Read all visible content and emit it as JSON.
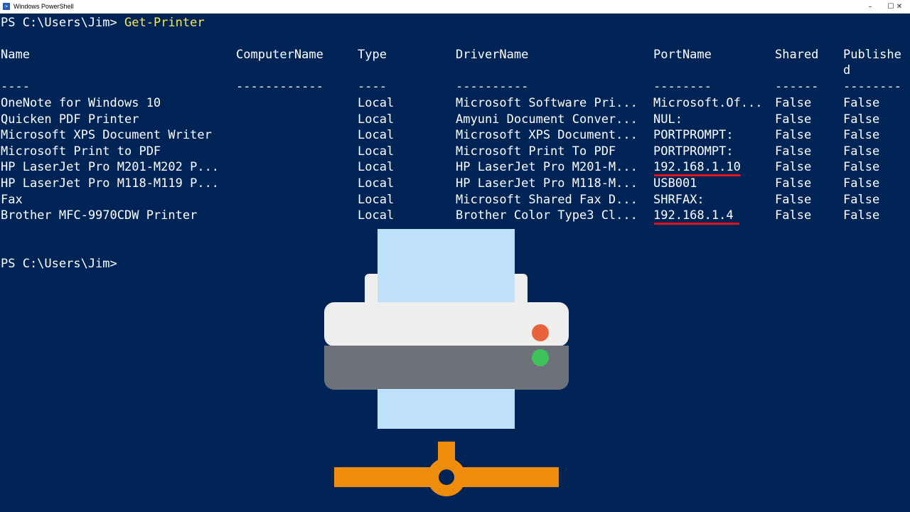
{
  "window": {
    "title": "Windows PowerShell",
    "controls": {
      "minimize": "–",
      "maximize": "☐",
      "close": "✕"
    }
  },
  "console": {
    "prompt1": "PS C:\\Users\\Jim>",
    "command": "Get-Printer",
    "headers": [
      "Name",
      "ComputerName",
      "Type",
      "DriverName",
      "PortName",
      "Shared",
      "Publishe"
    ],
    "header_wrap": "d",
    "separators": [
      "----",
      "------------",
      "----",
      "----------",
      "--------",
      "------",
      "--------"
    ],
    "rows": [
      [
        "OneNote for Windows 10",
        "",
        "Local",
        "Microsoft Software Pri...",
        "Microsoft.Of...",
        "False",
        "False"
      ],
      [
        "Quicken PDF Printer",
        "",
        "Local",
        "Amyuni Document Conver...",
        "NUL:",
        "False",
        "False"
      ],
      [
        "Microsoft XPS Document Writer",
        "",
        "Local",
        "Microsoft XPS Document...",
        "PORTPROMPT:",
        "False",
        "False"
      ],
      [
        "Microsoft Print to PDF",
        "",
        "Local",
        "Microsoft Print To PDF",
        "PORTPROMPT:",
        "False",
        "False"
      ],
      [
        "HP LaserJet Pro M201-M202 P...",
        "",
        "Local",
        "HP LaserJet Pro M201-M...",
        "192.168.1.10",
        "False",
        "False"
      ],
      [
        "HP LaserJet Pro M118-M119 P...",
        "",
        "Local",
        "HP LaserJet Pro M118-M...",
        "USB001",
        "False",
        "False"
      ],
      [
        "Fax",
        "",
        "Local",
        "Microsoft Shared Fax D...",
        "SHRFAX:",
        "False",
        "False"
      ],
      [
        "Brother MFC-9970CDW Printer",
        "",
        "Local",
        "Brother Color Type3 Cl...",
        "192.168.1.4",
        "False",
        "False"
      ]
    ],
    "underlined_row_indices": [
      4,
      7
    ],
    "prompt2": "PS C:\\Users\\Jim>"
  },
  "colors": {
    "background": "#012456",
    "text": "#ffffff",
    "command": "#f9e84e",
    "underline": "#e0111b",
    "printer_paper": "#bfe0fb",
    "printer_body": "#eeeeef",
    "printer_band": "#6d727a",
    "light_red": "#e8623a",
    "light_green": "#3fc45c",
    "network": "#f08c0c"
  },
  "icons": [
    "powershell-icon",
    "printer-icon",
    "network-icon"
  ]
}
